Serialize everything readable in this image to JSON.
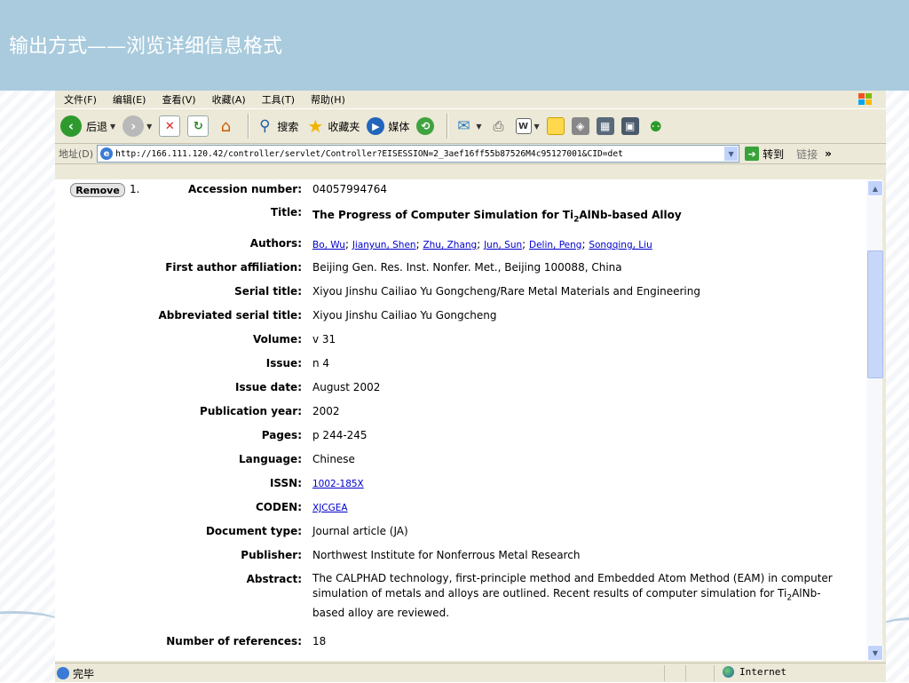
{
  "slide": {
    "title": "输出方式——浏览详细信息格式"
  },
  "menu": [
    "文件(F)",
    "编辑(E)",
    "查看(V)",
    "收藏(A)",
    "工具(T)",
    "帮助(H)"
  ],
  "toolbar": {
    "back": "后退",
    "search": "搜索",
    "favorites": "收藏夹",
    "media": "媒体"
  },
  "address": {
    "label": "地址(D)",
    "url": "http://166.111.120.42/controller/servlet/Controller?EISESSION=2_3aef16ff55b87526M4c95127001&CID=det",
    "go": "转到",
    "links": "链接"
  },
  "record": {
    "remove_label": "Remove",
    "number": "1.",
    "fields": {
      "accession_label": "Accession number:",
      "accession": "04057994764",
      "title_label": "Title:",
      "title_pre": "The Progress of Computer Simulation for Ti",
      "title_sub": "2",
      "title_post": "AlNb-based Alloy",
      "authors_label": "Authors:",
      "authors": [
        "Bo, Wu",
        "Jianyun, Shen",
        "Zhu, Zhang",
        "Jun, Sun",
        "Delin, Peng",
        "Songqing, Liu"
      ],
      "affiliation_label": "First author affiliation:",
      "affiliation": "Beijing Gen. Res. Inst. Nonfer. Met., Beijing 100088, China",
      "serial_label": "Serial title:",
      "serial": "Xiyou Jinshu Cailiao Yu Gongcheng/Rare Metal Materials and Engineering",
      "abbrev_label": "Abbreviated serial title:",
      "abbrev": "Xiyou Jinshu Cailiao Yu Gongcheng",
      "volume_label": "Volume:",
      "volume": "v 31",
      "issue_label": "Issue:",
      "issue": "n 4",
      "issue_date_label": "Issue date:",
      "issue_date": "August 2002",
      "pub_year_label": "Publication year:",
      "pub_year": "2002",
      "pages_label": "Pages:",
      "pages": "p 244-245",
      "language_label": "Language:",
      "language": "Chinese",
      "issn_label": "ISSN:",
      "issn": "1002-185X",
      "coden_label": "CODEN:",
      "coden": "XJCGEA",
      "doctype_label": "Document type:",
      "doctype": "Journal article (JA)",
      "publisher_label": "Publisher:",
      "publisher": "Northwest Institute for Nonferrous Metal Research",
      "abstract_label": "Abstract:",
      "abstract_main": "The CALPHAD technology, first-principle method and Embedded Atom Method (EAM) in computer simulation of metals and alloys are outlined. Recent results of computer simulation for Ti",
      "abstract_sub": "2",
      "abstract_post": "AlNb-based alloy are reviewed.",
      "refs_label": "Number of references:",
      "refs": "18"
    }
  },
  "status": {
    "text": "完毕",
    "zone": "Internet"
  }
}
